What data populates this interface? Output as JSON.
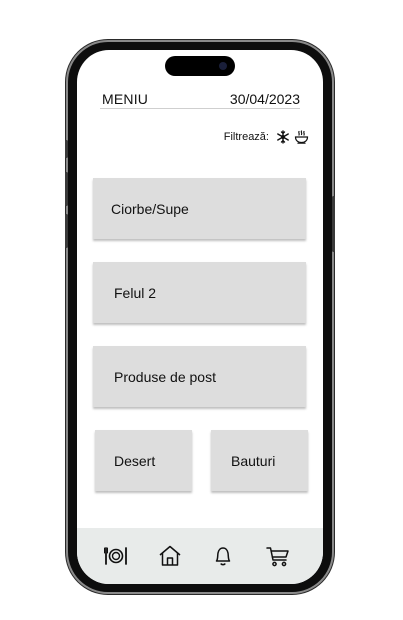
{
  "header": {
    "title": "MENIU",
    "date": "30/04/2023"
  },
  "filter": {
    "label": "Filtrează:",
    "icons": [
      "snowflake-icon",
      "hot-soup-icon"
    ]
  },
  "menu": {
    "categories": [
      {
        "label": "Ciorbe/Supe"
      },
      {
        "label": "Felul 2"
      },
      {
        "label": "Produse de post"
      },
      {
        "label": "Desert"
      },
      {
        "label": "Bauturi"
      }
    ]
  },
  "nav": {
    "items": [
      "menu-plate-icon",
      "home-icon",
      "bell-icon",
      "cart-icon"
    ]
  }
}
